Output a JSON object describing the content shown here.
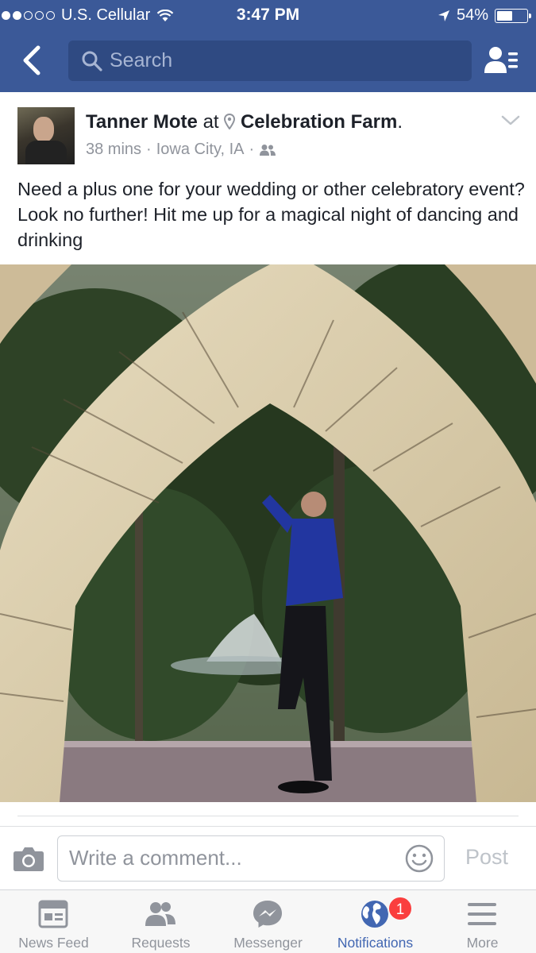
{
  "status_bar": {
    "carrier": "U.S. Cellular",
    "time": "3:47 PM",
    "battery": "54%",
    "battery_level": 0.54,
    "signal_bars": 2
  },
  "nav": {
    "search_placeholder": "Search"
  },
  "post": {
    "author": "Tanner Mote",
    "at_text": "at",
    "place": "Celebration Farm",
    "period": ".",
    "time_ago": "38 mins",
    "location": "Iowa City, IA",
    "separator": "·",
    "text": "Need a plus one for your wedding or other celebratory event? Look no further! Hit me up for a magical night of dancing and drinking"
  },
  "comment": {
    "placeholder": "Write a comment...",
    "post_label": "Post"
  },
  "tabs": [
    {
      "label": "News Feed",
      "icon": "news-feed-icon"
    },
    {
      "label": "Requests",
      "icon": "friend-requests-icon"
    },
    {
      "label": "Messenger",
      "icon": "messenger-icon"
    },
    {
      "label": "Notifications",
      "icon": "globe-icon",
      "badge": "1",
      "active": true
    },
    {
      "label": "More",
      "icon": "menu-icon"
    }
  ],
  "colors": {
    "brand": "#3b5998",
    "active_tab": "#4267b2",
    "badge": "#fa3e3e"
  }
}
